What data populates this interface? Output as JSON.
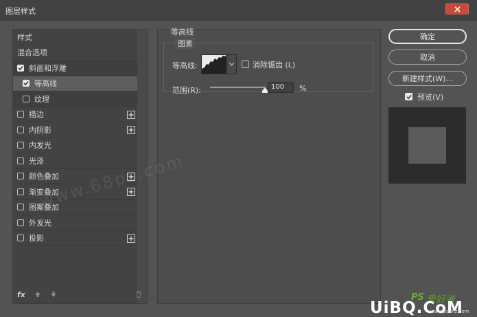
{
  "window": {
    "title": "图层样式"
  },
  "sidebar": {
    "header_styles": "样式",
    "header_blend": "混合选项",
    "items": [
      {
        "label": "斜面和浮雕",
        "checked": true,
        "plus": false,
        "indent": false,
        "state": "bevel"
      },
      {
        "label": "等高线",
        "checked": true,
        "plus": false,
        "indent": true,
        "state": "active"
      },
      {
        "label": "纹理",
        "checked": false,
        "plus": false,
        "indent": true,
        "state": "sub"
      },
      {
        "label": "描边",
        "checked": false,
        "plus": true,
        "indent": false,
        "state": ""
      },
      {
        "label": "内阴影",
        "checked": false,
        "plus": true,
        "indent": false,
        "state": ""
      },
      {
        "label": "内发光",
        "checked": false,
        "plus": false,
        "indent": false,
        "state": ""
      },
      {
        "label": "光泽",
        "checked": false,
        "plus": false,
        "indent": false,
        "state": ""
      },
      {
        "label": "颜色叠加",
        "checked": false,
        "plus": true,
        "indent": false,
        "state": ""
      },
      {
        "label": "渐变叠加",
        "checked": false,
        "plus": true,
        "indent": false,
        "state": ""
      },
      {
        "label": "图案叠加",
        "checked": false,
        "plus": false,
        "indent": false,
        "state": ""
      },
      {
        "label": "外发光",
        "checked": false,
        "plus": false,
        "indent": false,
        "state": ""
      },
      {
        "label": "投影",
        "checked": false,
        "plus": true,
        "indent": false,
        "state": ""
      }
    ],
    "fx_label": "fx"
  },
  "main": {
    "section_title": "等高线",
    "group_title": "图素",
    "contour_label": "等高线:",
    "anti_alias_label": "消除锯齿 (L)",
    "anti_alias_checked": false,
    "range_label": "范围(R):",
    "range_value": "100",
    "range_unit": "%",
    "range_fraction": 1.0
  },
  "buttons": {
    "ok": "确定",
    "cancel": "取消",
    "new_style": "新建样式(W)...",
    "preview_label": "预览(V)",
    "preview_checked": true
  },
  "watermark": {
    "text": "www.68ps.com"
  },
  "logo": {
    "ps": "PS",
    "cn": "爱好者",
    "main": "UiBQ.CoM",
    "site": "www.psahz.com"
  },
  "colors": {
    "bg": "#535353",
    "panel": "#434343",
    "active_row": "#5e5e5e",
    "close": "#c84b3c"
  }
}
